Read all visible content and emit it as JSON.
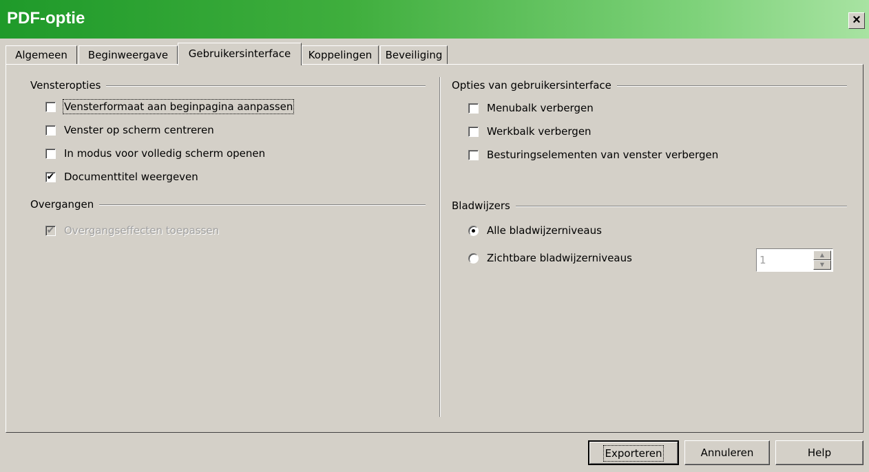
{
  "window": {
    "title": "PDF-optie",
    "close_label": "×"
  },
  "tabs": [
    {
      "label": "Algemeen",
      "active": false
    },
    {
      "label": "Beginweergave",
      "active": false
    },
    {
      "label": "Gebruikersinterface",
      "active": true
    },
    {
      "label": "Koppelingen",
      "active": false
    },
    {
      "label": "Beveiliging",
      "active": false
    }
  ],
  "window_options": {
    "title": "Vensteropties",
    "items": [
      {
        "label": "Vensterformaat aan beginpagina aanpassen",
        "checked": false
      },
      {
        "label": "Venster op scherm centreren",
        "checked": false
      },
      {
        "label": "In modus voor volledig scherm openen",
        "checked": false
      },
      {
        "label": "Documenttitel weergeven",
        "checked": true
      }
    ]
  },
  "transitions": {
    "title": "Overgangen",
    "items": [
      {
        "label": "Overgangseffecten toepassen",
        "checked": true,
        "disabled": true
      }
    ]
  },
  "ui_options": {
    "title": "Opties van gebruikersinterface",
    "items": [
      {
        "label": "Menubalk verbergen",
        "checked": false
      },
      {
        "label": "Werkbalk verbergen",
        "checked": false
      },
      {
        "label": "Besturingselementen van venster verbergen",
        "checked": false
      }
    ]
  },
  "bookmarks": {
    "title": "Bladwijzers",
    "options": [
      {
        "label": "Alle bladwijzerniveaus",
        "selected": true
      },
      {
        "label": "Zichtbare bladwijzerniveaus",
        "selected": false
      }
    ],
    "level_value": "1"
  },
  "buttons": {
    "export": "Exporteren",
    "cancel": "Annuleren",
    "help": "Help"
  },
  "glyphs": {
    "check": "✔",
    "spin_up": "▲",
    "spin_down": "▼"
  }
}
